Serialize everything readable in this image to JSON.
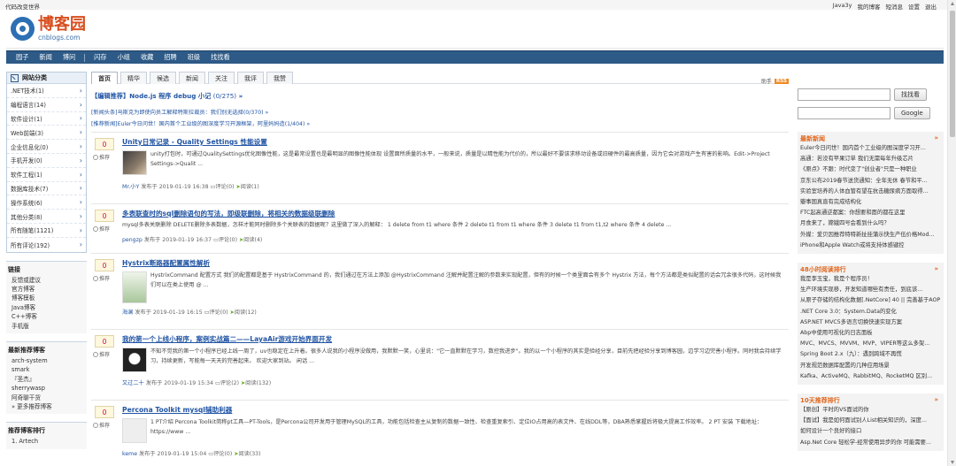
{
  "topbar": {
    "slogan": "代码改变世界",
    "links": [
      "Java3y",
      "我的博客",
      "短消息",
      "设置",
      "退出"
    ]
  },
  "logo": {
    "cn": "博客园",
    "en": "cnblogs.com"
  },
  "nav": [
    "园子",
    "新闻",
    "博问",
    "闪存",
    "小组",
    "收藏",
    "招聘",
    "班级",
    "找找看"
  ],
  "categories": {
    "title": "网站分类",
    "items": [
      {
        "label": ".NET技术(1)"
      },
      {
        "label": "编程语言(14)"
      },
      {
        "label": "软件设计(1)"
      },
      {
        "label": "Web前端(3)"
      },
      {
        "label": "企业信息化(0)"
      },
      {
        "label": "手机开发(0)"
      },
      {
        "label": "软件工程(1)"
      },
      {
        "label": "数据库技术(7)"
      },
      {
        "label": "操作系统(6)"
      },
      {
        "label": "其他分类(8)"
      },
      {
        "label": "所有随笔(1121)"
      },
      {
        "label": "所有评论(192)"
      }
    ]
  },
  "links": {
    "title": "链接",
    "items": [
      "反馈或建议",
      "官方博客",
      "博客模板",
      "Java博客",
      "C++博客",
      "手机版"
    ]
  },
  "recommended": {
    "title": "最新推荐博客",
    "items": [
      "arch-system",
      "smark",
      "『圣杰』",
      "sherrywasp",
      "阿奇聊干货",
      "» 更多推荐博客"
    ]
  },
  "ranking": {
    "title": "推荐博客排行",
    "items": [
      "1. Artech"
    ]
  },
  "tabs": [
    "首页",
    "精华",
    "候选",
    "新闻",
    "关注",
    "我评",
    "我赞"
  ],
  "rss": {
    "label": "助手",
    "badge": "RSS"
  },
  "editor": {
    "prefix": "【编辑推荐】Node.js 程序 debug 小记",
    "count": "(0/275)",
    "arrow": "»"
  },
  "news_lines": [
    "[新闻头条]马斯克为即使向员工解释特斯拉裁员：我们别无选择(0/370) »",
    "[推荐新闻]Euler今日问世！国内首个工业级的图深度学习开源框架，阿里妈妈造(1/404) »"
  ],
  "posts": [
    {
      "digg": "0",
      "recommend": "推荐",
      "title": "Unity日常记录 - Quality Settings 性能设置",
      "summary": "unity打包时，可通过QualitySettings优化图像性能，这是最常设置也是最明显的图像性能体现 设置面所质量的水平，一般来说，质量是以精性能为代价的，所以最好不要该求移动设备或旧硬件的最高质量，因为它会对游戏产生有害的影响。Edit->Project Settings->Qualit ...",
      "author": "Mr.小Y",
      "date": "发布于 2019-01-19 16:38",
      "comments": "评论(0)",
      "views": "阅读(1)"
    },
    {
      "digg": "0",
      "recommend": "推荐",
      "title": "多表联查时的sql删除语句的写法，即级联删除，将相关的数据级联删除",
      "summary": "mysql多表关联删除 DELETE删除多表数据，怎样才能同时删除多个关联表的数据呢？这里做了深入的解释： 1 delete from t1 where 条件 2 delete t1 from t1 where 条件 3 delete t1 from t1,t2 where 条件 4 delete ...",
      "author": "pengzp",
      "date": "发布于 2019-01-19 16:37",
      "comments": "评论(0)",
      "views": "阅读(4)"
    },
    {
      "digg": "0",
      "recommend": "推荐",
      "title": "Hystrix断路器配置属性解析",
      "summary": "HystrixCommand 配置方式 我们的配置都是基于 HystrixCommand 的，我们通过在方法上添加 @HystrixCommand 注解并配置注解的参数来实现配置，但有的时候一个类里面会有多个 Hystrix 方法，每个方法都是类似配置的话会冗余很多代码，这时候我们可以在类上使用 @ ...",
      "author": "海澜",
      "date": "发布于 2019-01-19 16:15",
      "comments": "评论(0)",
      "views": "阅读(12)"
    },
    {
      "digg": "0",
      "recommend": "推荐",
      "title": "我的第一个上线小程序，案例实战篇二——LayaAir游戏开始界面开发",
      "summary": "不知不觉我的第一个小程序已经上线一周了，uv也稳定在上升着。很多人说我的小程序没做用，我默默一笑，心里说：\"它一直默默在学习，数控我进步\"。我的以一个小程序的其实是验经分享，目前先把经验分享到博客园，边学习边完善小程序。同时我会持续学习，持续更新，写能每一天天的完善起来。 欢迎大家到站。 闲话 ...",
      "author": "又过二十",
      "date": "发布于 2019-01-19 15:34",
      "comments": "评论(2)",
      "views": "阅读(132)"
    },
    {
      "digg": "0",
      "recommend": "推荐",
      "title": "Percona Toolkit mysql辅助利器",
      "summary": "1 PT介绍 Percona Toolkit简称pt工具—PT-Tools，是Percona公司开发用于管理MySQL的工具，功能包括检查主从复制的数据一致性、检查重复索引、定位IO占用高的表文件、在线DDL等，DBA熟悉掌握后将极大提高工作效率。 2 PT 安装 下载地址：https://www ...",
      "author": "keme",
      "date": "发布于 2019-01-19 15:04",
      "comments": "评论(0)",
      "views": "阅读(33)"
    }
  ],
  "search": {
    "zzk_button": "找找看",
    "google_button": "Google"
  },
  "latest_news": {
    "title": "最新新闻",
    "more": "»",
    "items": [
      "Euler今日问世！国内首个工业级的图深度学习开...",
      "高通：若没有苹果订单 我们无需每年升级芯片",
      "《原点》不跟：时代变了\"创业者\"只是一种职业",
      "京东公布2019春节送货通知：全年无休 春节和平...",
      "实验室培养的人体血管有望在抗击糖尿病方面取得...",
      "瓣事国真直有完成结构化",
      "FTC起高通逆都案：你想要和面的都在这里",
      "月食来了，嫦娥四号会看到什么吗？",
      "外媒：爱贝因推荐特特新扯挂蒲示快生产伍价格Mod...",
      "iPhone和Apple Watch或将支持体感键控"
    ]
  },
  "read_rank": {
    "title": "48小时阅读排行",
    "more": "»",
    "items": [
      "我是李玉宝，我是个程序员！",
      "生产环境实现移，开发知道哪些有责任，到底该...",
      "从原子存储的结构化数据[.NetCore] 40 || 完善基于AOP...",
      ".NET Core 3.0：System.Data的变化",
      "ASP.NET MVC5多语言切换快速实现方案",
      "Abp中使用可视化的日志面板",
      "MVC、MVCS、MVVM、MVP、VIPER等这么多架...",
      "Spring Boot 2.x（九）：遇到跨域不再慌",
      "开发规范数据库配置的几种应用场景",
      "Kafka、ActiveMQ、RabbitMQ、RocketMQ 区别..."
    ]
  },
  "recommend_rank": {
    "title": "10天推荐排行",
    "more": "»",
    "items": [
      "【原创】平时的VS面试的你",
      "【面试】我是如何面试别人List相关知识的，深度...",
      "如何设计一个良好的接口",
      "Asp.Net Core 轻松学-经常使用异步的你 可能需要..."
    ]
  }
}
